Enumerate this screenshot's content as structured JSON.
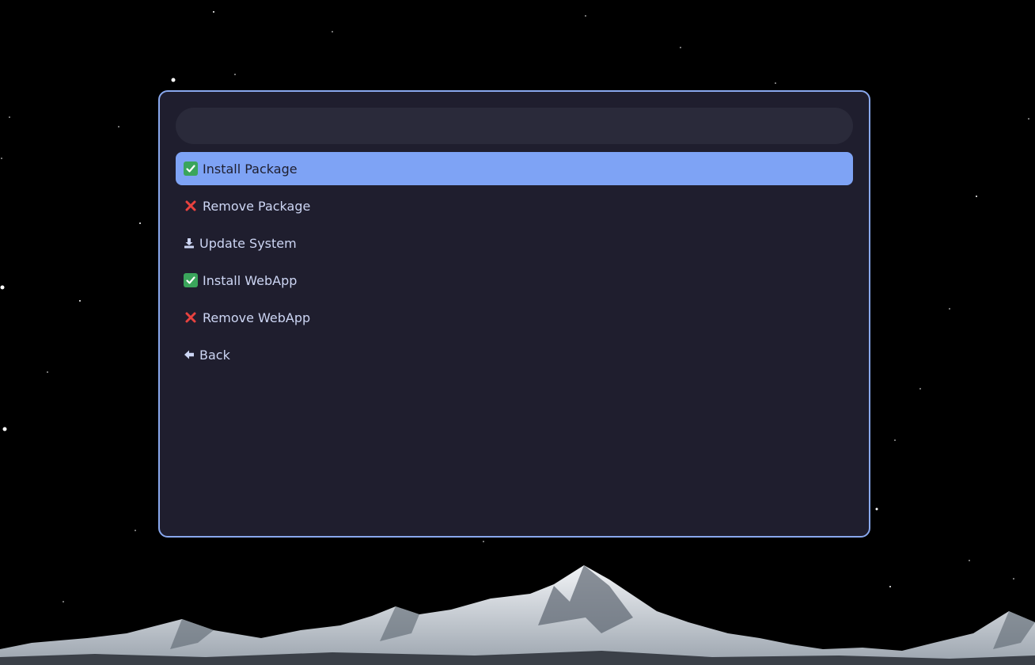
{
  "search": {
    "value": "",
    "placeholder": ""
  },
  "menu": {
    "items": [
      {
        "label": "Install Package",
        "icon": "check-mark-icon",
        "selected": true
      },
      {
        "label": "Remove Package",
        "icon": "cross-mark-icon",
        "selected": false
      },
      {
        "label": "Update System",
        "icon": "download-icon",
        "selected": false
      },
      {
        "label": "Install WebApp",
        "icon": "check-mark-icon",
        "selected": false
      },
      {
        "label": "Remove WebApp",
        "icon": "cross-mark-icon",
        "selected": false
      },
      {
        "label": "Back",
        "icon": "arrow-left-icon",
        "selected": false
      }
    ]
  },
  "colors": {
    "panel_bg": "#1f1e2e",
    "panel_border": "#89a8ee",
    "search_bg": "#2a2a3a",
    "selected_bg": "#7ea3f5",
    "text": "#cdd6f4",
    "selected_text": "#1e1e2e"
  }
}
